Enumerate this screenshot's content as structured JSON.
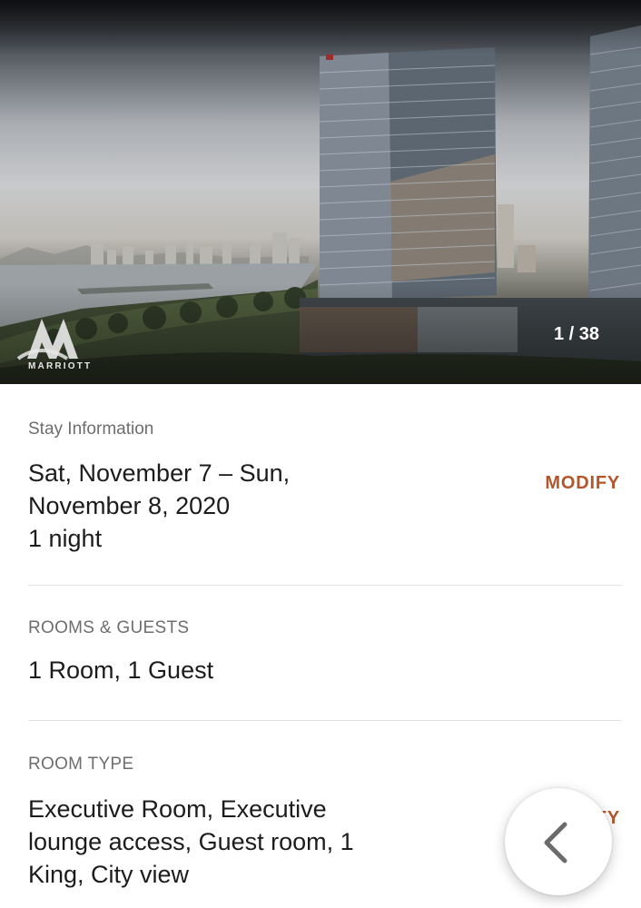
{
  "hero": {
    "brand_name": "MARRIOTT",
    "photo_counter": "1 / 38"
  },
  "stay": {
    "label": "Stay Information",
    "dates_line1": "Sat, November 7 – Sun,",
    "dates_line2": "November 8, 2020",
    "nights": "1 night",
    "action": "MODIFY"
  },
  "rooms": {
    "label": "ROOMS & GUESTS",
    "value": "1 Room, 1 Guest"
  },
  "room_type": {
    "label": "ROOM TYPE",
    "line1": "Executive Room, Executive",
    "line2": "lounge access, Guest room, 1",
    "line3": "King, City view",
    "action": "MODIFY"
  },
  "icons": {
    "back": "chevron-left-icon",
    "logo": "marriott-logo"
  },
  "colors": {
    "accent": "#b5562a",
    "label": "#6e6e6e",
    "text": "#1c1c1c",
    "divider": "#e2e2e2"
  }
}
